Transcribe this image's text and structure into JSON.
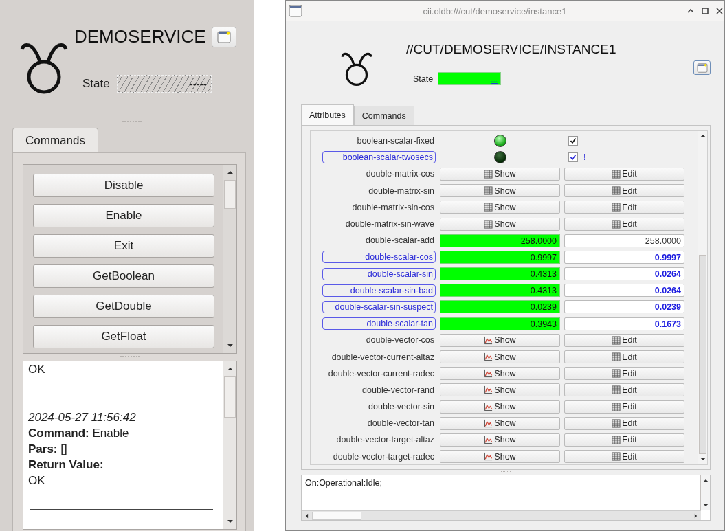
{
  "left_panel": {
    "title": "DEMOSERVICE",
    "state_label": "State",
    "state_value": "-----",
    "tabs": [
      {
        "label": "Commands",
        "selected": true
      }
    ],
    "commands": [
      "Disable",
      "Enable",
      "Exit",
      "GetBoolean",
      "GetDouble",
      "GetFloat"
    ],
    "log": [
      {
        "kind": "text",
        "text": "OK"
      },
      {
        "kind": "rule"
      },
      {
        "kind": "time",
        "text": "2024-05-27 11:56:42"
      },
      {
        "kind": "text",
        "text": "**Command:** Enable"
      },
      {
        "kind": "text",
        "text": "**Pars:** []"
      },
      {
        "kind": "bold",
        "text": "Return Value:"
      },
      {
        "kind": "text",
        "text": "OK"
      },
      {
        "kind": "rule"
      }
    ]
  },
  "window": {
    "title": "cii.oldb:///cut/demoservice/instance1",
    "heading": "//CUT/DEMOSERVICE/INSTANCE1",
    "state_label": "State",
    "state_value": "...",
    "tabs": [
      {
        "label": "Attributes",
        "selected": true
      },
      {
        "label": "Commands",
        "selected": false
      }
    ],
    "attributes": [
      {
        "kind": "boolean",
        "name": "boolean-scalar-fixed",
        "highlighted": false,
        "led_on": true,
        "checked": true
      },
      {
        "kind": "boolean",
        "name": "boolean-scalar-twosecs",
        "highlighted": true,
        "led_on": false,
        "checked": true,
        "flag": "!"
      },
      {
        "kind": "matrix",
        "name": "double-matrix-cos",
        "show": "Show",
        "edit": "Edit"
      },
      {
        "kind": "matrix",
        "name": "double-matrix-sin",
        "show": "Show",
        "edit": "Edit"
      },
      {
        "kind": "matrix",
        "name": "double-matrix-sin-cos",
        "show": "Show",
        "edit": "Edit"
      },
      {
        "kind": "matrix",
        "name": "double-matrix-sin-wave",
        "show": "Show",
        "edit": "Edit"
      },
      {
        "kind": "scalar",
        "name": "double-scalar-add",
        "highlighted": false,
        "value": "258.0000",
        "set_value": "258.0000"
      },
      {
        "kind": "scalar",
        "name": "double-scalar-cos",
        "highlighted": true,
        "value": "0.9997",
        "set_value": "0.9997"
      },
      {
        "kind": "scalar",
        "name": "double-scalar-sin",
        "highlighted": true,
        "value": "0.4313",
        "set_value": "0.0264"
      },
      {
        "kind": "scalar",
        "name": "double-scalar-sin-bad",
        "highlighted": true,
        "value": "0.4313",
        "set_value": "0.0264"
      },
      {
        "kind": "scalar",
        "name": "double-scalar-sin-suspect",
        "highlighted": true,
        "value": "0.0239",
        "set_value": "0.0239"
      },
      {
        "kind": "scalar",
        "name": "double-scalar-tan",
        "highlighted": true,
        "value": "0.3943",
        "set_value": "0.1673"
      },
      {
        "kind": "vector",
        "name": "double-vector-cos",
        "show": "Show",
        "edit": "Edit"
      },
      {
        "kind": "vector",
        "name": "double-vector-current-altaz",
        "show": "Show",
        "edit": "Edit"
      },
      {
        "kind": "vector",
        "name": "double-vector-current-radec",
        "show": "Show",
        "edit": "Edit"
      },
      {
        "kind": "vector",
        "name": "double-vector-rand",
        "show": "Show",
        "edit": "Edit"
      },
      {
        "kind": "vector",
        "name": "double-vector-sin",
        "show": "Show",
        "edit": "Edit"
      },
      {
        "kind": "vector",
        "name": "double-vector-tan",
        "show": "Show",
        "edit": "Edit"
      },
      {
        "kind": "vector",
        "name": "double-vector-target-altaz",
        "show": "Show",
        "edit": "Edit"
      },
      {
        "kind": "vector",
        "name": "double-vector-target-radec",
        "show": "Show",
        "edit": "Edit"
      }
    ],
    "output": "On:Operational:Idle;"
  }
}
